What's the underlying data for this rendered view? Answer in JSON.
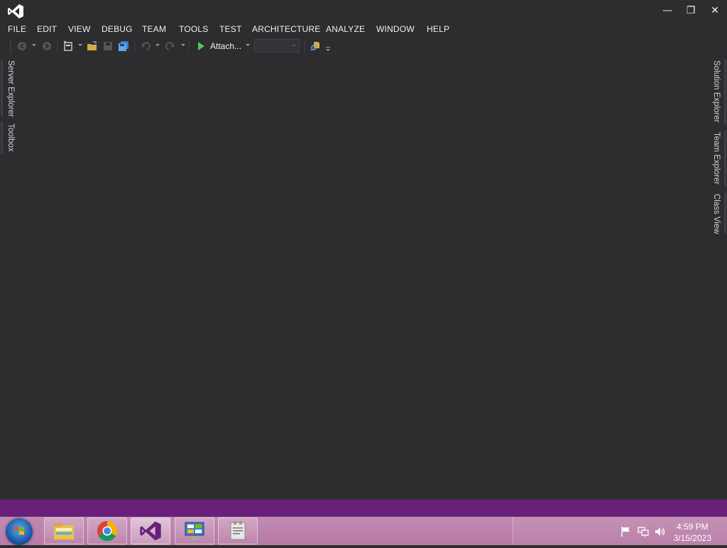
{
  "window": {
    "title_controls": {
      "minimize": "—",
      "restore": "❐",
      "close": "✕"
    }
  },
  "menu": {
    "items": [
      "FILE",
      "EDIT",
      "VIEW",
      "DEBUG",
      "TEAM",
      "TOOLS",
      "TEST",
      "ARCHITECTURE",
      "ANALYZE",
      "WINDOW",
      "HELP"
    ]
  },
  "toolbar": {
    "attach_label": "Attach...",
    "icons": [
      "back-icon",
      "forward-icon",
      "new-project-icon",
      "open-file-icon",
      "save-icon",
      "save-all-icon",
      "undo-icon",
      "redo-icon",
      "start-icon",
      "find-in-files-icon"
    ]
  },
  "left_tabs": [
    "Server Explorer",
    "Toolbox"
  ],
  "right_tabs": [
    "Solution Explorer",
    "Team Explorer",
    "Class View"
  ],
  "taskbar": {
    "apps": [
      "file-explorer-icon",
      "chrome-icon",
      "visual-studio-icon",
      "control-panel-icon",
      "notepad-icon"
    ],
    "clock_time": "4:59 PM",
    "clock_date": "3/15/2023"
  },
  "colors": {
    "background": "#2d2d30",
    "accent": "#68217a",
    "taskbar": "#bb80aa",
    "text": "#f1f1f1"
  }
}
